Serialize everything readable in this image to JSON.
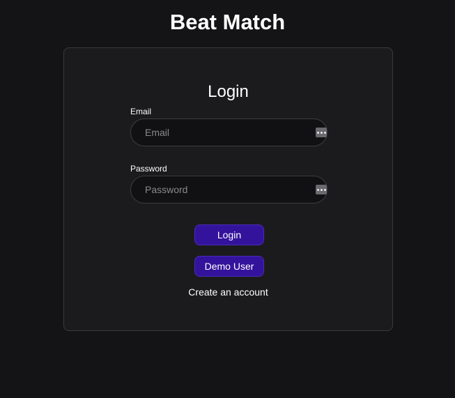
{
  "app": {
    "title": "Beat Match"
  },
  "login_form": {
    "title": "Login",
    "email": {
      "label": "Email",
      "placeholder": "Email",
      "value": ""
    },
    "password": {
      "label": "Password",
      "placeholder": "Password",
      "value": ""
    },
    "login_button": "Login",
    "demo_button": "Demo User",
    "create_account_link": "Create an account"
  },
  "icons": {
    "field_autofill": "password-manager-key-icon"
  },
  "colors": {
    "background": "#141416",
    "card": "#1b1b1d",
    "button": "#34139c"
  }
}
